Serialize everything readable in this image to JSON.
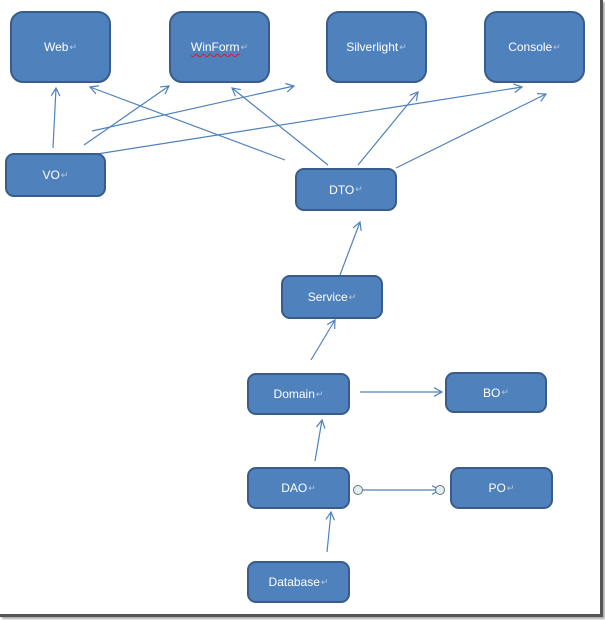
{
  "diagram": {
    "colors": {
      "node_fill": "#4f81bd",
      "node_border": "#385d8a",
      "edge": "#4f81bd",
      "text": "#ffffff"
    },
    "paragraph_mark": "↵",
    "nodes": [
      {
        "id": "web",
        "label": "Web"
      },
      {
        "id": "winform",
        "label": "WinForm",
        "spellcheck_underline": true
      },
      {
        "id": "silverlight",
        "label": "Silverlight"
      },
      {
        "id": "console",
        "label": "Console"
      },
      {
        "id": "vo",
        "label": "VO"
      },
      {
        "id": "dto",
        "label": "DTO"
      },
      {
        "id": "service",
        "label": "Service"
      },
      {
        "id": "domain",
        "label": "Domain"
      },
      {
        "id": "bo",
        "label": "BO"
      },
      {
        "id": "dao",
        "label": "DAO"
      },
      {
        "id": "po",
        "label": "PO"
      },
      {
        "id": "database",
        "label": "Database"
      }
    ],
    "edges": [
      {
        "from": "vo",
        "to": "web"
      },
      {
        "from": "vo",
        "to": "winform"
      },
      {
        "from": "vo",
        "to": "silverlight"
      },
      {
        "from": "vo",
        "to": "console"
      },
      {
        "from": "dto",
        "to": "web"
      },
      {
        "from": "dto",
        "to": "winform"
      },
      {
        "from": "dto",
        "to": "silverlight"
      },
      {
        "from": "dto",
        "to": "console"
      },
      {
        "from": "service",
        "to": "dto"
      },
      {
        "from": "domain",
        "to": "service"
      },
      {
        "from": "domain",
        "to": "bo"
      },
      {
        "from": "dao",
        "to": "domain"
      },
      {
        "from": "dao",
        "to": "po",
        "style": "connector-handles"
      },
      {
        "from": "database",
        "to": "dao"
      }
    ]
  }
}
